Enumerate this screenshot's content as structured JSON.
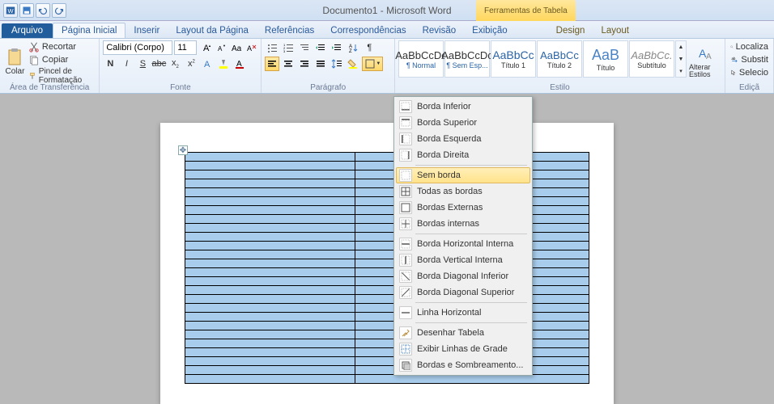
{
  "titlebar": {
    "document_title": "Documento1 - Microsoft Word",
    "context_group": "Ferramentas de Tabela"
  },
  "tabs": {
    "file": "Arquivo",
    "items": [
      "Página Inicial",
      "Inserir",
      "Layout da Página",
      "Referências",
      "Correspondências",
      "Revisão",
      "Exibição"
    ],
    "context": [
      "Design",
      "Layout"
    ],
    "active_index": 0
  },
  "ribbon": {
    "clipboard": {
      "paste": "Colar",
      "cut": "Recortar",
      "copy": "Copiar",
      "format_painter": "Pincel de Formatação",
      "group_title": "Área de Transferência"
    },
    "font": {
      "font_name": "Calibri (Corpo)",
      "font_size": "11",
      "group_title": "Fonte"
    },
    "paragraph": {
      "group_title": "Parágrafo"
    },
    "styles": {
      "items": [
        {
          "preview": "AaBbCcDc",
          "label": "¶ Normal"
        },
        {
          "preview": "AaBbCcDc",
          "label": "¶ Sem Esp..."
        },
        {
          "preview": "AaBbCc",
          "label": "Título 1"
        },
        {
          "preview": "AaBbCc",
          "label": "Título 2"
        },
        {
          "preview": "AaB",
          "label": "Título"
        },
        {
          "preview": "AaBbCc.",
          "label": "Subtítulo"
        }
      ],
      "change_styles": "Alterar Estilos",
      "group_title": "Estilo"
    },
    "editing": {
      "find": "Localiza",
      "replace": "Substit",
      "select": "Selecio",
      "group_title": "Ediçã"
    }
  },
  "borders_menu": {
    "items": [
      {
        "label": "Borda Inferior",
        "key": "I"
      },
      {
        "label": "Borda Superior",
        "key": "u"
      },
      {
        "label": "Borda Esquerda",
        "key": "E"
      },
      {
        "label": "Borda Direita",
        "key": "D"
      },
      {
        "label": "Sem borda",
        "key": "S",
        "hover": true
      },
      {
        "label": "Todas as bordas",
        "key": "T"
      },
      {
        "label": "Bordas Externas",
        "key": "E"
      },
      {
        "label": "Bordas internas",
        "key": "r"
      },
      {
        "label": "Borda Horizontal Interna",
        "key": "H"
      },
      {
        "label": "Borda Vertical Interna",
        "key": "V"
      },
      {
        "label": "Borda Diagonal Inferior",
        "key": "I"
      },
      {
        "label": "Borda Diagonal Superior",
        "key": "S"
      },
      {
        "label": "Linha Horizontal",
        "key": "L"
      },
      {
        "label": "Desenhar Tabela",
        "key": "D"
      },
      {
        "label": "Exibir Linhas de Grade",
        "key": "G"
      },
      {
        "label": "Bordas e Sombreamento...",
        "key": "B"
      }
    ]
  },
  "table": {
    "rows": 26,
    "cols": 2
  }
}
